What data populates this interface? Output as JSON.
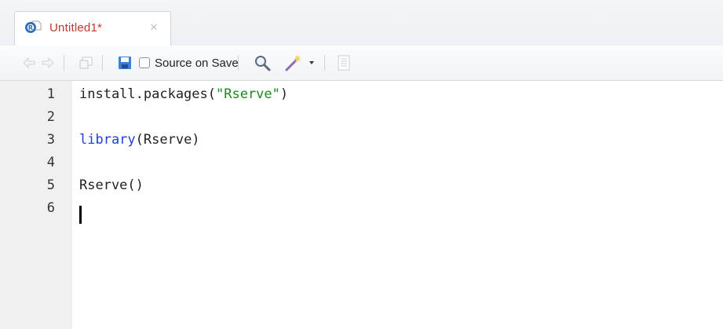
{
  "tab": {
    "title": "Untitled1*",
    "close_glyph": "×",
    "icon": "r-document-icon"
  },
  "toolbar": {
    "back_icon": "arrow-left-icon",
    "forward_icon": "arrow-right-icon",
    "show_in_window_icon": "popout-icon",
    "save_icon": "save-icon",
    "source_on_save_label": "Source on Save",
    "source_on_save_checked": false,
    "search_icon": "magnifier-icon",
    "code_tools_icon": "magic-wand-icon",
    "outline_icon": "document-outline-icon"
  },
  "editor": {
    "line_numbers": [
      "1",
      "2",
      "3",
      "4",
      "5",
      "6"
    ],
    "line1": {
      "fn": "install.packages(",
      "str": "\"Rserve\"",
      "close": ")"
    },
    "line3": {
      "kw": "library",
      "rest": "(Rserve)"
    },
    "line5": {
      "text": "Rserve()"
    }
  },
  "colors": {
    "keyword": "#1f3ed6",
    "string": "#1a8a1a",
    "tab_title": "#c0392b",
    "gutter": "#f0f0f0"
  }
}
